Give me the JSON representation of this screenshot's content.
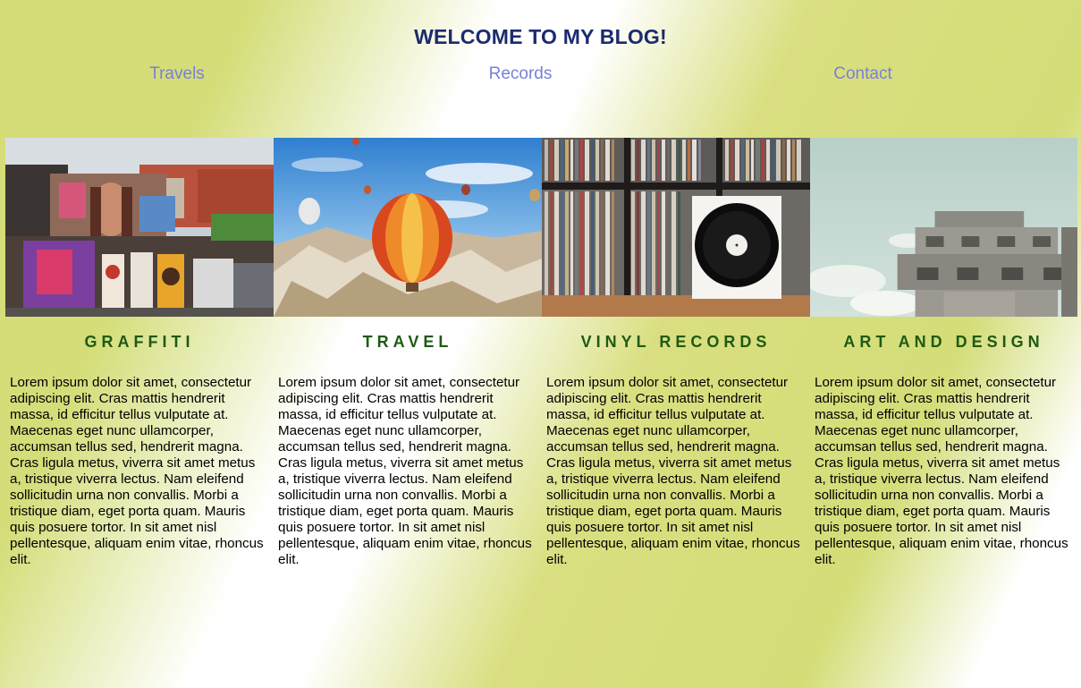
{
  "header": {
    "title": "WELCOME TO MY BLOG!"
  },
  "nav": {
    "items": [
      {
        "label": "Travels"
      },
      {
        "label": "Records"
      },
      {
        "label": "Contact"
      }
    ]
  },
  "cards": [
    {
      "heading": "GRAFFITI",
      "image": "graffiti-street-mural-photo",
      "text": "Lorem ipsum dolor sit amet, consectetur adipiscing elit. Cras mattis hendrerit massa, id efficitur tellus vulputate at. Maecenas eget nunc ullamcorper, accumsan tellus sed, hendrerit magna. Cras ligula metus, viverra sit amet metus a, tristique viverra lectus. Nam eleifend sollicitudin urna non convallis. Morbi a tristique diam, eget porta quam. Mauris quis posuere tortor. In sit amet nisl pellentesque, aliquam enim vitae, rhoncus elit."
    },
    {
      "heading": "TRAVEL",
      "image": "hot-air-balloon-photo",
      "text": "Lorem ipsum dolor sit amet, consectetur adipiscing elit. Cras mattis hendrerit massa, id efficitur tellus vulputate at. Maecenas eget nunc ullamcorper, accumsan tellus sed, hendrerit magna. Cras ligula metus, viverra sit amet metus a, tristique viverra lectus. Nam eleifend sollicitudin urna non convallis. Morbi a tristique diam, eget porta quam. Mauris quis posuere tortor. In sit amet nisl pellentesque, aliquam enim vitae, rhoncus elit."
    },
    {
      "heading": "VINYL RECORDS",
      "image": "vinyl-record-shelf-photo",
      "text": "Lorem ipsum dolor sit amet, consectetur adipiscing elit. Cras mattis hendrerit massa, id efficitur tellus vulputate at. Maecenas eget nunc ullamcorper, accumsan tellus sed, hendrerit magna. Cras ligula metus, viverra sit amet metus a, tristique viverra lectus. Nam eleifend sollicitudin urna non convallis. Morbi a tristique diam, eget porta quam. Mauris quis posuere tortor. In sit amet nisl pellentesque, aliquam enim vitae, rhoncus elit."
    },
    {
      "heading": "ART AND DESIGN",
      "image": "concrete-building-photo",
      "text": "Lorem ipsum dolor sit amet, consectetur adipiscing elit. Cras mattis hendrerit massa, id efficitur tellus vulputate at. Maecenas eget nunc ullamcorper, accumsan tellus sed, hendrerit magna. Cras ligula metus, viverra sit amet metus a, tristique viverra lectus. Nam eleifend sollicitudin urna non convallis. Morbi a tristique diam, eget porta quam. Mauris quis posuere tortor. In sit amet nisl pellentesque, aliquam enim vitae, rhoncus elit."
    }
  ],
  "colors": {
    "title": "#1c2a6e",
    "nav_link": "#7a7fd8",
    "card_heading": "#1f5a14",
    "background_green": "#d4dd78"
  }
}
